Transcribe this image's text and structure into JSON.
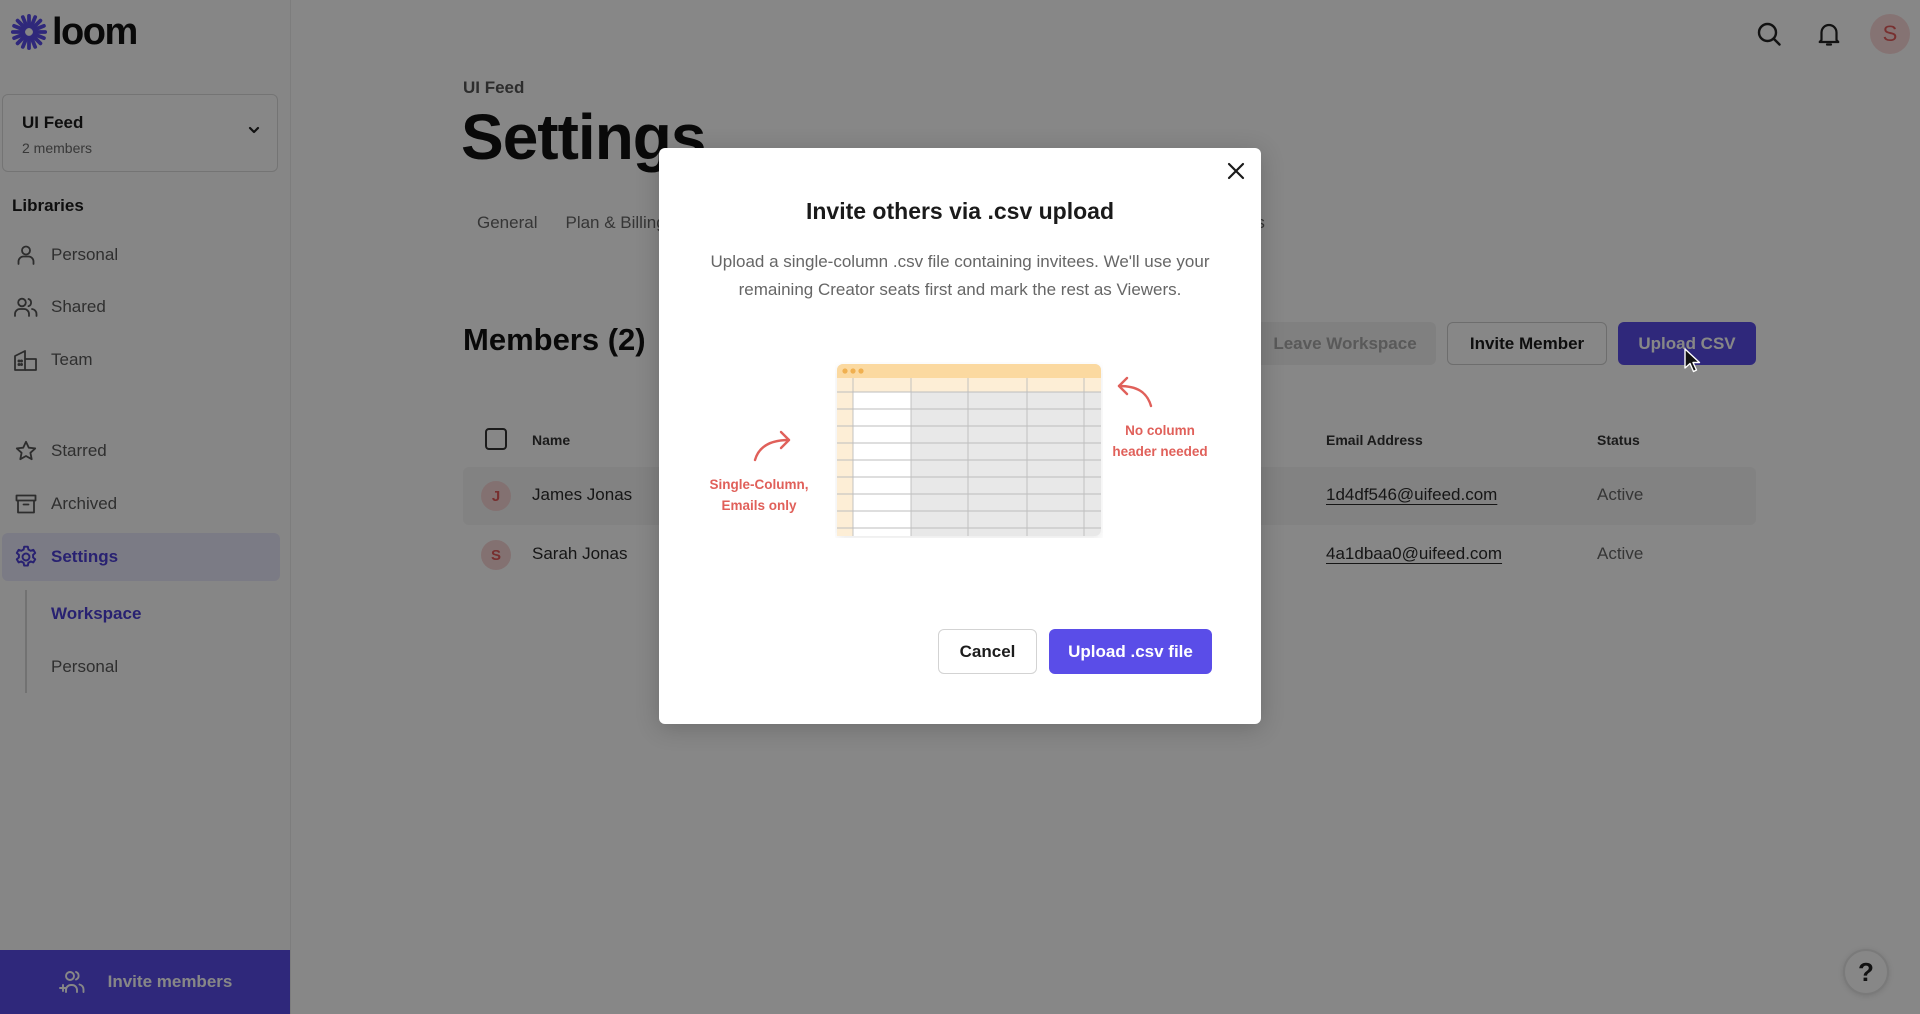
{
  "app": {
    "logo_text": "loom",
    "brand_color": "#5a4de8"
  },
  "sidebar": {
    "workspace": {
      "name": "UI Feed",
      "members": "2 members"
    },
    "libraries_label": "Libraries",
    "libraries": [
      {
        "label": "Personal",
        "icon": "person-icon"
      },
      {
        "label": "Shared",
        "icon": "people-icon"
      },
      {
        "label": "Team",
        "icon": "building-icon"
      }
    ],
    "items": [
      {
        "label": "Starred",
        "icon": "star-icon"
      },
      {
        "label": "Archived",
        "icon": "archive-icon"
      },
      {
        "label": "Settings",
        "icon": "gear-icon",
        "active": true
      }
    ],
    "settings_sub": [
      {
        "label": "Workspace",
        "active": true
      },
      {
        "label": "Personal"
      }
    ],
    "invite_label": "Invite members"
  },
  "header": {
    "avatar_initial": "S"
  },
  "main": {
    "breadcrumb": "UI Feed",
    "title": "Settings",
    "tabs": [
      {
        "label": "General"
      },
      {
        "label": "Plan & Billing"
      },
      {
        "label": "Members"
      }
    ],
    "members_title": "Members (2)",
    "buttons": {
      "leave": "Leave Workspace",
      "invite": "Invite Member",
      "upload_csv": "Upload CSV"
    },
    "table": {
      "headers": {
        "name": "Name",
        "email": "Email Address",
        "status": "Status"
      },
      "rows": [
        {
          "initial": "J",
          "name": "James Jonas",
          "email": "1d4df546@uifeed.com",
          "status": "Active"
        },
        {
          "initial": "S",
          "name": "Sarah Jonas",
          "email": "4a1dbaa0@uifeed.com",
          "status": "Active"
        }
      ]
    }
  },
  "modal": {
    "title": "Invite others via .csv upload",
    "description": "Upload a single-column .csv file containing invitees. We'll use your remaining Creator seats first and mark the rest as Viewers.",
    "annotation_left": "Single-Column, Emails only",
    "annotation_right": "No column header needed",
    "cancel_label": "Cancel",
    "upload_label": "Upload .csv file"
  },
  "help_label": "?"
}
